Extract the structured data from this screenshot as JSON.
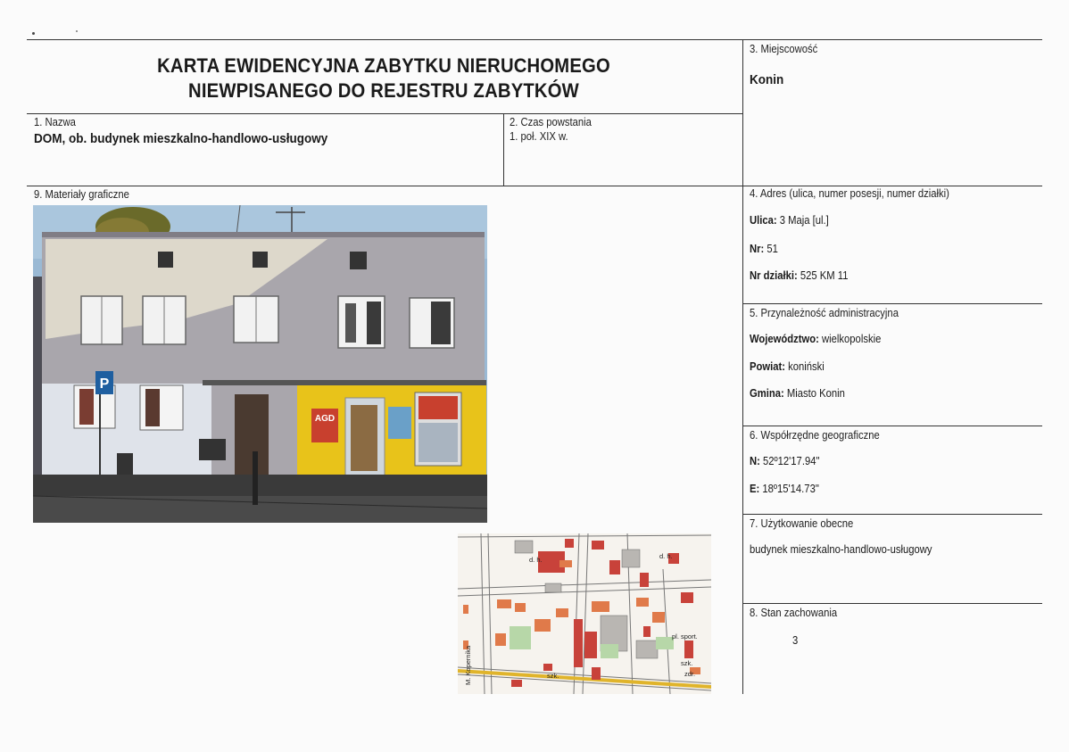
{
  "header": {
    "title_line1": "KARTA EWIDENCYJNA ZABYTKU NIERUCHOMEGO",
    "title_line2": "NIEWPISANEGO DO REJESTRU ZABYTKÓW"
  },
  "fields": {
    "miejscowosc": {
      "label": "3. Miejscowość",
      "value": "Konin"
    },
    "nazwa": {
      "label": "1. Nazwa",
      "value": "DOM, ob. budynek mieszkalno-handlowo-usługowy"
    },
    "czas": {
      "label": "2. Czas powstania",
      "value": "1. poł. XIX w."
    },
    "materialy": {
      "label": "9. Materiały graficzne"
    },
    "adres": {
      "label": "4. Adres (ulica, numer posesji, numer działki)",
      "ulica_key": "Ulica:",
      "ulica_val": "3 Maja [ul.]",
      "nr_key": "Nr:",
      "nr_val": "51",
      "dzialka_key": "Nr działki:",
      "dzialka_val": "525 KM 11"
    },
    "przynaleznosc": {
      "label": "5. Przynależność administracyjna",
      "woj_key": "Województwo:",
      "woj_val": "wielkopolskie",
      "powiat_key": "Powiat:",
      "powiat_val": "koniński",
      "gmina_key": "Gmina:",
      "gmina_val": "Miasto Konin"
    },
    "wspolrzedne": {
      "label": "6. Współrzędne geograficzne",
      "n_key": "N:",
      "n_val": "52º12'17.94\"",
      "e_key": "E:",
      "e_val": "18º15'14.73\""
    },
    "uzytkowanie": {
      "label": "7. Użytkowanie obecne",
      "value": "budynek mieszkalno-handlowo-usługowy"
    },
    "stan": {
      "label": "8. Stan zachowania",
      "value": "3"
    }
  },
  "photo": {
    "sign_text": "AGD",
    "parking_letter": "P"
  },
  "map": {
    "labels": [
      "d. h.",
      "szk.",
      "szk.",
      "d. h.",
      "zdr.",
      "M. Kopernika",
      "pl. sport."
    ]
  },
  "colors": {
    "ink": "#1a1a1a",
    "building_wall": "#a9a6ac",
    "shop_yellow": "#e8c31a",
    "sky": "#9ab9d4",
    "map_red": "#c8423a"
  }
}
